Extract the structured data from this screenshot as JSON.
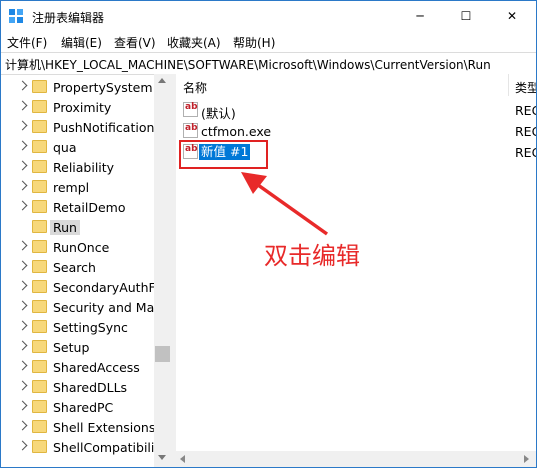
{
  "window": {
    "title": "注册表编辑器",
    "minimize_glyph": "─",
    "maximize_glyph": "☐",
    "close_glyph": "✕"
  },
  "menu": [
    "文件(F)",
    "编辑(E)",
    "查看(V)",
    "收藏夹(A)",
    "帮助(H)"
  ],
  "address": "计算机\\HKEY_LOCAL_MACHINE\\SOFTWARE\\Microsoft\\Windows\\CurrentVersion\\Run",
  "tree": {
    "items": [
      {
        "label": "PropertySystem",
        "selected": false
      },
      {
        "label": "Proximity",
        "selected": false
      },
      {
        "label": "PushNotifications",
        "selected": false
      },
      {
        "label": "qua",
        "selected": false
      },
      {
        "label": "Reliability",
        "selected": false
      },
      {
        "label": "rempl",
        "selected": false
      },
      {
        "label": "RetailDemo",
        "selected": false
      },
      {
        "label": "Run",
        "selected": true
      },
      {
        "label": "RunOnce",
        "selected": false
      },
      {
        "label": "Search",
        "selected": false
      },
      {
        "label": "SecondaryAuthFa",
        "selected": false
      },
      {
        "label": "Security and Main",
        "selected": false
      },
      {
        "label": "SettingSync",
        "selected": false
      },
      {
        "label": "Setup",
        "selected": false
      },
      {
        "label": "SharedAccess",
        "selected": false
      },
      {
        "label": "SharedDLLs",
        "selected": false
      },
      {
        "label": "SharedPC",
        "selected": false
      },
      {
        "label": "Shell Extensions",
        "selected": false
      },
      {
        "label": "ShellCompatibility",
        "selected": false
      }
    ]
  },
  "list": {
    "columns": {
      "name": "名称",
      "type": "类型"
    },
    "rows": [
      {
        "icon": "string-value-icon",
        "icon_text": "ab",
        "name": "(默认)",
        "type": "REG"
      },
      {
        "icon": "string-value-icon",
        "icon_text": "ab",
        "name": "ctfmon.exe",
        "type": "REG"
      },
      {
        "icon": "string-value-icon",
        "icon_text": "ab",
        "name": "新值 #1",
        "type": "REG",
        "editing": true
      }
    ]
  },
  "annotation": {
    "text": "双击编辑",
    "color": "#e82a2a"
  },
  "colors": {
    "accent": "#0078d7",
    "window_border": "#2b79c8",
    "folder": "#f7d87b"
  }
}
